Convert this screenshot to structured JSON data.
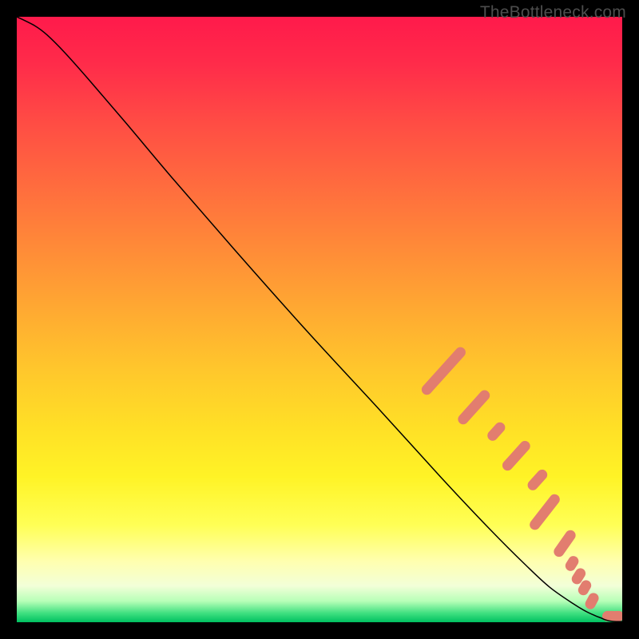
{
  "watermark": "TheBottleneck.com",
  "chart_data": {
    "type": "line",
    "title": "",
    "xlabel": "",
    "ylabel": "",
    "xlim": [
      0,
      100
    ],
    "ylim": [
      0,
      100
    ],
    "grid": false,
    "legend": false,
    "background": {
      "type": "gradient",
      "direction": "vertical",
      "stops": [
        {
          "pos": 0.0,
          "color": "#ff1a4b"
        },
        {
          "pos": 0.08,
          "color": "#ff2c4a"
        },
        {
          "pos": 0.18,
          "color": "#ff4e44"
        },
        {
          "pos": 0.28,
          "color": "#ff6c3e"
        },
        {
          "pos": 0.38,
          "color": "#ff8a38"
        },
        {
          "pos": 0.48,
          "color": "#ffa832"
        },
        {
          "pos": 0.58,
          "color": "#ffc62c"
        },
        {
          "pos": 0.68,
          "color": "#ffe026"
        },
        {
          "pos": 0.76,
          "color": "#fff326"
        },
        {
          "pos": 0.84,
          "color": "#ffff56"
        },
        {
          "pos": 0.9,
          "color": "#ffffb0"
        },
        {
          "pos": 0.94,
          "color": "#f2ffd8"
        },
        {
          "pos": 0.965,
          "color": "#b8ffb8"
        },
        {
          "pos": 0.985,
          "color": "#40e080"
        },
        {
          "pos": 1.0,
          "color": "#00c060"
        }
      ]
    },
    "series": [
      {
        "name": "bottleneck-curve",
        "color": "#000000",
        "stroke_width": 1.5,
        "x": [
          0,
          3,
          5,
          8,
          12,
          18,
          26,
          36,
          48,
          60,
          70,
          78,
          84,
          88,
          92,
          94,
          95.5,
          96.5,
          97.2,
          98,
          99,
          100
        ],
        "y": [
          100,
          98.5,
          97,
          94,
          89.5,
          82.5,
          73,
          61.5,
          48,
          35,
          24,
          15.5,
          9.5,
          5.8,
          3.0,
          1.8,
          1.1,
          0.7,
          0.4,
          0.2,
          0.1,
          0.1
        ]
      }
    ],
    "markers": {
      "comment": "salmon ovals overlaid on the curve in the lower-right region",
      "color": "#e27d6f",
      "shape": "capsule",
      "items": [
        {
          "x": 70.5,
          "y": 41.5,
          "len": 10,
          "angle": -48
        },
        {
          "x": 75.5,
          "y": 35.5,
          "len": 7,
          "angle": -48
        },
        {
          "x": 79.2,
          "y": 31.5,
          "len": 3.5,
          "angle": -48
        },
        {
          "x": 82.5,
          "y": 27.5,
          "len": 6,
          "angle": -48
        },
        {
          "x": 86.0,
          "y": 23.5,
          "len": 4,
          "angle": -48
        },
        {
          "x": 87.2,
          "y": 18.2,
          "len": 7,
          "angle": -52
        },
        {
          "x": 90.5,
          "y": 13.0,
          "len": 5,
          "angle": -55
        },
        {
          "x": 91.7,
          "y": 9.7,
          "len": 2.6,
          "angle": -58
        },
        {
          "x": 92.8,
          "y": 7.6,
          "len": 2.8,
          "angle": -58
        },
        {
          "x": 93.8,
          "y": 5.7,
          "len": 2.6,
          "angle": -60
        },
        {
          "x": 95.0,
          "y": 3.5,
          "len": 2.8,
          "angle": -62
        },
        {
          "x": 98.0,
          "y": 1.0,
          "len": 2.6,
          "angle": 0
        },
        {
          "x": 99.2,
          "y": 1.0,
          "len": 2.2,
          "angle": 0
        }
      ]
    }
  }
}
